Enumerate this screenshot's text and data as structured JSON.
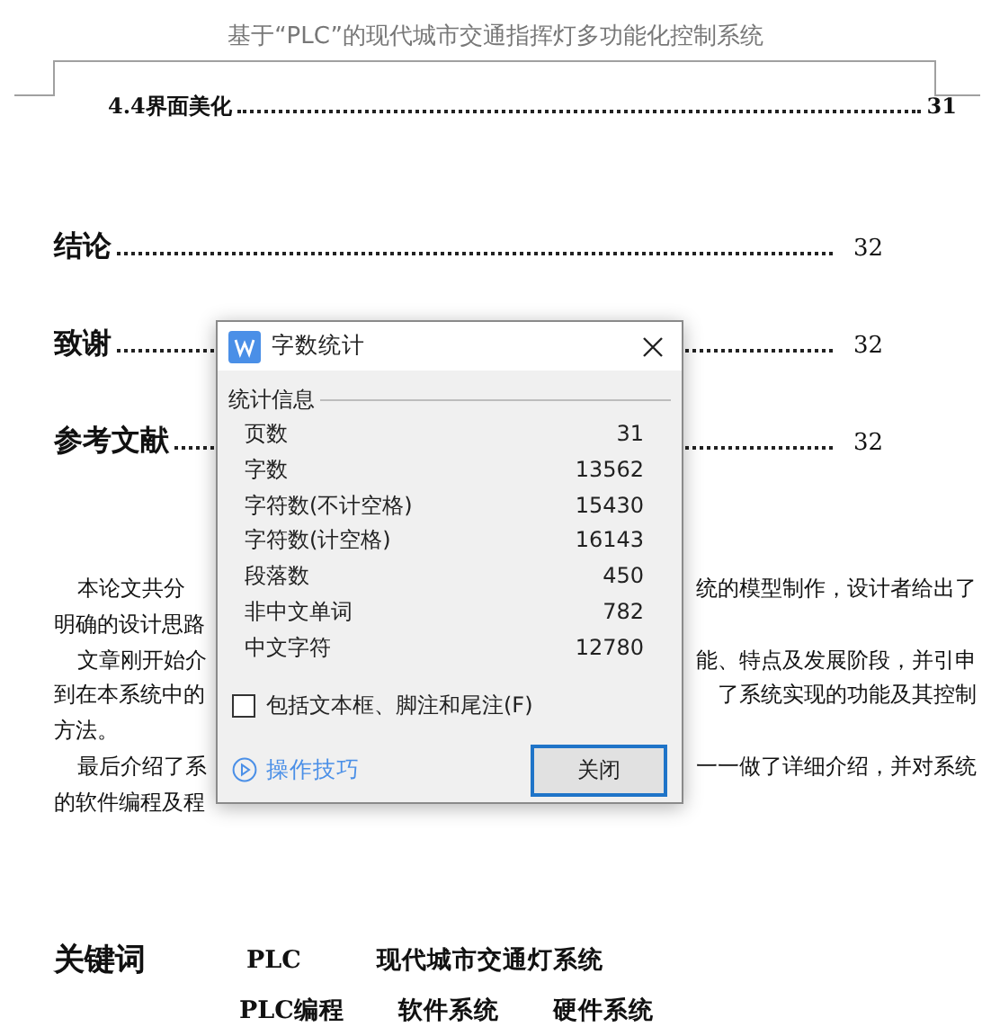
{
  "header": {
    "title": "基于“PLC”的现代城市交通指挥灯多功能化控制系统"
  },
  "toc": [
    {
      "kind": "sub",
      "label": "4.4界面美化",
      "page": "31"
    },
    {
      "kind": "chapter",
      "label": "结论",
      "page": "32"
    },
    {
      "kind": "chapter",
      "label": "致谢",
      "page": "32"
    },
    {
      "kind": "chapter",
      "label": "参考文献",
      "page": "32"
    }
  ],
  "abstract_lines": [
    {
      "kind": "start",
      "left": "本论文共分",
      "right": "统的模型制作，设计者给出了"
    },
    {
      "kind": "wrap",
      "left": "明确的设计思路"
    },
    {
      "kind": "start",
      "left": "文章刚开始介",
      "right": "能、特点及发展阶段，并引申"
    },
    {
      "kind": "wrap",
      "left": "到在本系统中的",
      "right": "了系统实现的功能及其控制"
    },
    {
      "kind": "wrap",
      "left": "方法。"
    },
    {
      "kind": "start",
      "left": "最后介绍了系",
      "right": "一一做了详细介绍，并对系统"
    },
    {
      "kind": "wrap",
      "left": "的软件编程及程"
    }
  ],
  "keywords": {
    "label": "关键词",
    "rows": [
      [
        "PLC",
        "现代城市交通灯系统"
      ],
      [
        "PLC编程",
        "软件系统",
        "硬件系统"
      ]
    ]
  },
  "dialog": {
    "title": "字数统计",
    "group_label": "统计信息",
    "stats": [
      {
        "label": "页数",
        "value": "31"
      },
      {
        "label": "字数",
        "value": "13562"
      },
      {
        "label": "字符数(不计空格)",
        "value": "15430"
      },
      {
        "label": "字符数(计空格)",
        "value": "16143"
      },
      {
        "label": "段落数",
        "value": "450"
      },
      {
        "label": "非中文单词",
        "value": "782"
      },
      {
        "label": "中文字符",
        "value": "12780"
      }
    ],
    "include_checkbox": {
      "label": "包括文本框、脚注和尾注(F)",
      "checked": false
    },
    "tips_link": "操作技巧",
    "close_button": "关闭"
  }
}
